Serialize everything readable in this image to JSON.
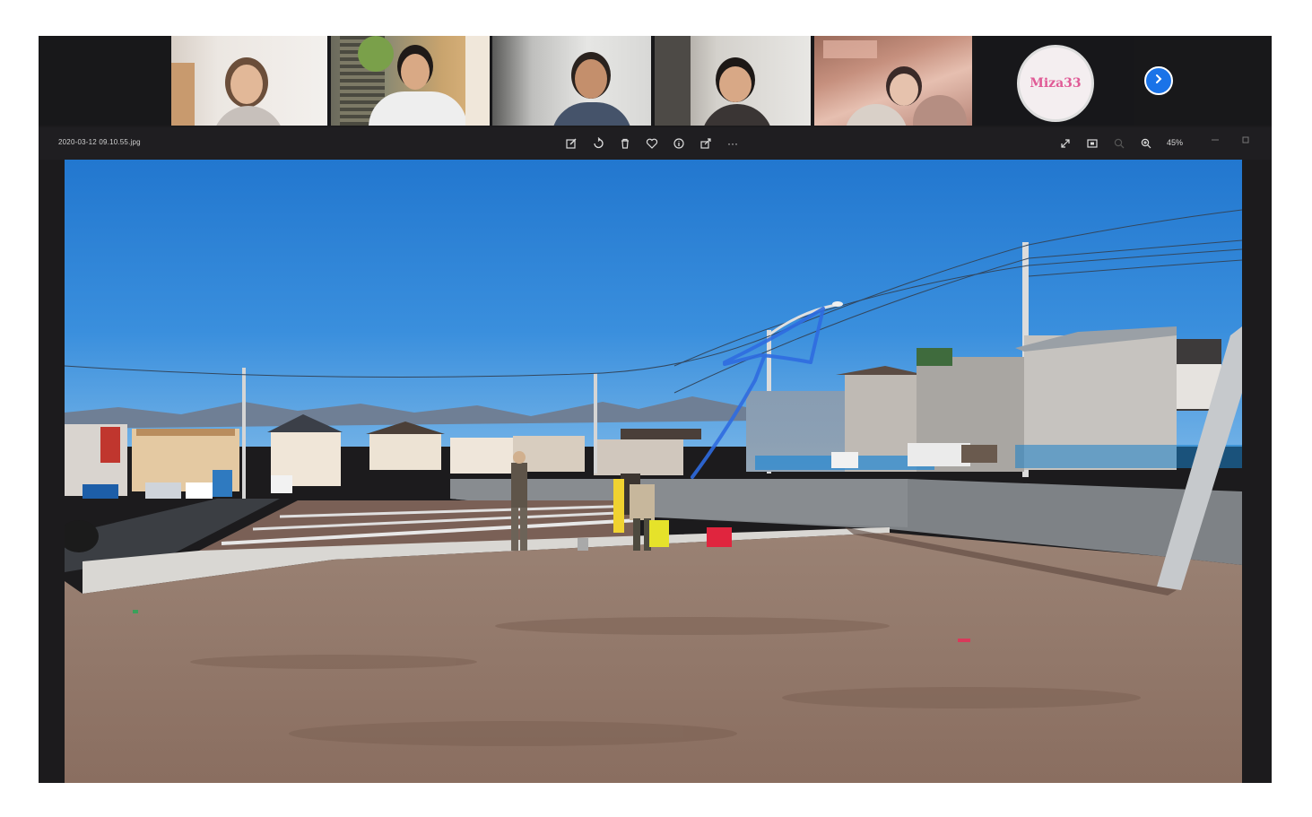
{
  "participants": [
    {
      "name": "",
      "kind": "video"
    },
    {
      "name": "",
      "kind": "video",
      "active": true
    },
    {
      "name": "",
      "kind": "video"
    },
    {
      "name": "",
      "kind": "video"
    },
    {
      "name": "",
      "kind": "video"
    },
    {
      "name": "Miza33",
      "kind": "avatar"
    }
  ],
  "viewer": {
    "filename": "2020-03-12 09.10.55.jpg",
    "zoom": "45%",
    "toolbar_icons": [
      "edit-icon",
      "rotate-icon",
      "delete-icon",
      "favorite-icon",
      "info-icon",
      "share-icon",
      "more-icon"
    ],
    "right_icons": [
      "fullscreen-icon",
      "fit-icon",
      "zoom-out-icon",
      "zoom-in-icon"
    ],
    "more_label": "···"
  },
  "colors": {
    "background": "#1c1b1d",
    "accent": "#1a73e8",
    "sky": "#2f86d8",
    "ground": "#8f7668",
    "annotation": "#2f6be0"
  }
}
